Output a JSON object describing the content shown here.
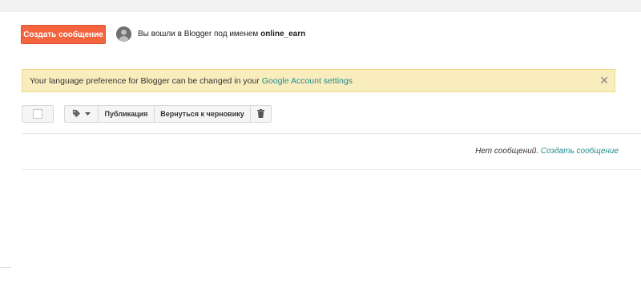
{
  "header": {
    "create_post_label": "Создать сообщение",
    "logged_in_prefix": "Вы вошли в Blogger под именем",
    "username": "online_earn"
  },
  "notice": {
    "text": "Your language preference for Blogger can be changed in your",
    "link": "Google Account settings",
    "close": "✕"
  },
  "toolbar": {
    "label_icon": "tag-icon",
    "publish_label": "Публикация",
    "revert_label": "Вернуться к черновику",
    "delete_icon": "trash-icon"
  },
  "empty_state": {
    "text": "Нет сообщений.",
    "link": "Создать сообщение"
  },
  "colors": {
    "accent": "#f3643f",
    "link": "#1f8b8b",
    "notice_bg": "#f9edbe"
  }
}
